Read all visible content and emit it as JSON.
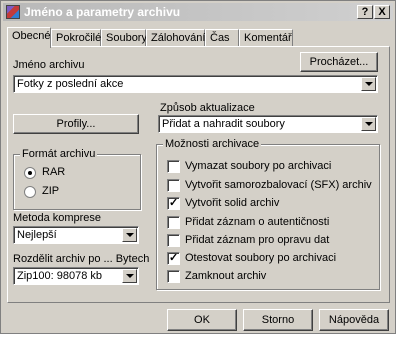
{
  "window": {
    "title": "Jméno a parametry archivu",
    "help_label": "?",
    "close_label": "X"
  },
  "tabs": [
    {
      "label": "Obecné"
    },
    {
      "label": "Pokročilé"
    },
    {
      "label": "Soubory"
    },
    {
      "label": "Zálohování"
    },
    {
      "label": "Čas"
    },
    {
      "label": "Komentář"
    }
  ],
  "archive_name": {
    "label": "Jméno archivu",
    "value": "Fotky z poslední akce",
    "browse_label": "Procházet..."
  },
  "update_mode": {
    "label": "Způsob aktualizace",
    "value": "Přidat a nahradit soubory"
  },
  "profiles_label": "Profily...",
  "format": {
    "label": "Formát archivu",
    "options": [
      {
        "label": "RAR",
        "selected": true
      },
      {
        "label": "ZIP",
        "selected": false
      }
    ]
  },
  "compression": {
    "label": "Metoda komprese",
    "value": "Nejlepší"
  },
  "split": {
    "label": "Rozdělit archiv po ... Bytech",
    "value": "Zip100:  98078 kb"
  },
  "options": {
    "label": "Možnosti archivace",
    "items": [
      {
        "label": "Vymazat soubory po archivaci",
        "checked": false
      },
      {
        "label": "Vytvořit samorozbalovací (SFX) archiv",
        "checked": false
      },
      {
        "label": "Vytvořit solid archiv",
        "checked": true
      },
      {
        "label": "Přidat záznam o autentičnosti",
        "checked": false
      },
      {
        "label": "Přidat záznam pro opravu dat",
        "checked": false
      },
      {
        "label": "Otestovat soubory po archivaci",
        "checked": true
      },
      {
        "label": "Zamknout archiv",
        "checked": false
      }
    ]
  },
  "buttons": {
    "ok": "OK",
    "cancel": "Storno",
    "help": "Nápověda"
  }
}
